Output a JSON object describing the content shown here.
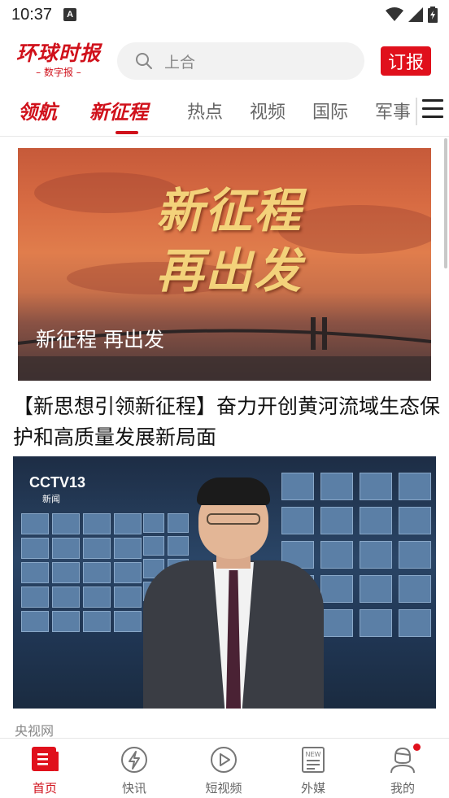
{
  "status_bar": {
    "time": "10:37",
    "notification_icon": "A"
  },
  "header": {
    "logo_main": "环球时报",
    "logo_sub": "– 数字报 –",
    "search_placeholder": "上合",
    "subscribe_label": "订报"
  },
  "tabs": {
    "items": [
      {
        "label": "领航",
        "style": "special"
      },
      {
        "label": "新征程",
        "style": "active"
      },
      {
        "label": "热点"
      },
      {
        "label": "视频"
      },
      {
        "label": "国际"
      },
      {
        "label": "军事"
      }
    ],
    "menu_icon": "menu-icon"
  },
  "feed": {
    "banner_art_text_line1": "新征程",
    "banner_art_text_line2": "再出发",
    "banner_caption": "新征程 再出发",
    "headline": "【新思想引领新征程】奋力开创黄河流域生态保护和高质量发展新局面",
    "video_channel_logo": "CCTV13",
    "video_channel_sub": "新闻",
    "source": "央视网"
  },
  "bottom_nav": {
    "items": [
      {
        "label": "首页",
        "icon": "home-icon",
        "active": true
      },
      {
        "label": "快讯",
        "icon": "lightning-icon"
      },
      {
        "label": "短视频",
        "icon": "play-icon"
      },
      {
        "label": "外媒",
        "icon": "new-paper-icon"
      },
      {
        "label": "我的",
        "icon": "profile-icon",
        "badge": true
      }
    ]
  },
  "colors": {
    "brand_red": "#d0111b",
    "text_dark": "#111111",
    "text_muted": "#888888"
  }
}
